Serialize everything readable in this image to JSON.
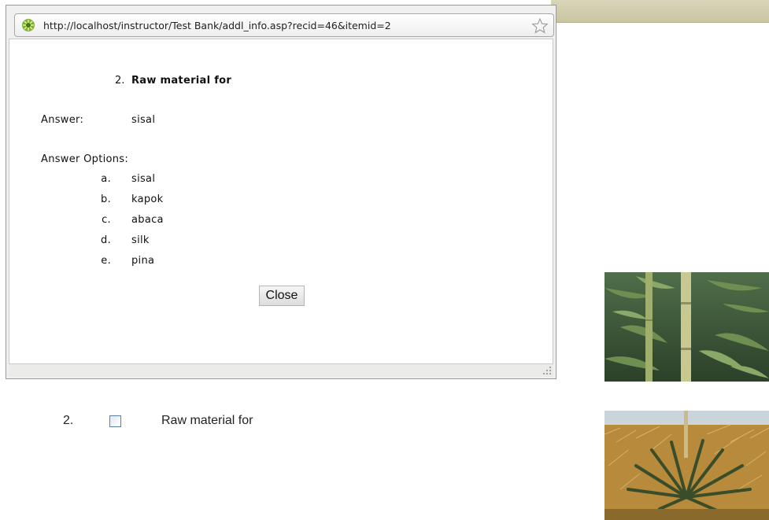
{
  "popup": {
    "url": "http://localhost/instructor/Test Bank/addl_info.asp?recid=46&itemid=2",
    "site_icon": "site-favicon-icon",
    "bookmark_icon": "star-icon",
    "question_number": "2.",
    "question_text": "Raw material for",
    "answer_label": "Answer:",
    "answer_value": "sisal",
    "options_label": "Answer Options:",
    "options": [
      {
        "letter": "a.",
        "text": "sisal"
      },
      {
        "letter": "b.",
        "text": "kapok"
      },
      {
        "letter": "c.",
        "text": "abaca"
      },
      {
        "letter": "d.",
        "text": "silk"
      },
      {
        "letter": "e.",
        "text": "pina"
      }
    ],
    "close_label": "Close",
    "resize_icon": "resize-grip-icon"
  },
  "page": {
    "question_number": "2.",
    "question_text": "Raw material for",
    "images": [
      {
        "name": "bamboo-photo"
      },
      {
        "name": "sisal-plant-photo"
      }
    ]
  }
}
